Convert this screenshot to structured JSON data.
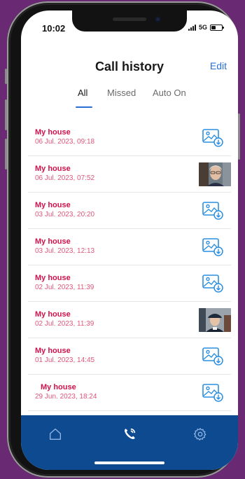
{
  "status_bar": {
    "time": "10:02",
    "network": "5G"
  },
  "header": {
    "title": "Call history",
    "edit_label": "Edit"
  },
  "tabs": [
    {
      "label": "All",
      "active": true
    },
    {
      "label": "Missed",
      "active": false
    },
    {
      "label": "Auto On",
      "active": false
    }
  ],
  "calls": [
    {
      "name": "My house",
      "date": "06 Jul. 2023, 09:18",
      "thumbnail": "image-download-icon"
    },
    {
      "name": "My house",
      "date": "06 Jul. 2023, 07:52",
      "thumbnail": "photo-person-glasses"
    },
    {
      "name": "My house",
      "date": "03 Jul. 2023, 20:20",
      "thumbnail": "image-download-icon"
    },
    {
      "name": "My house",
      "date": "03 Jul. 2023, 12:13",
      "thumbnail": "image-download-icon"
    },
    {
      "name": "My house",
      "date": "02 Jul. 2023, 11:39",
      "thumbnail": "image-download-icon"
    },
    {
      "name": "My house",
      "date": "02 Jul. 2023, 11:39",
      "thumbnail": "photo-person-cap"
    },
    {
      "name": "My house",
      "date": "01 Jul. 2023, 14:45",
      "thumbnail": "image-download-icon"
    },
    {
      "name": "My house",
      "date": "29 Jun. 2023, 18:24",
      "thumbnail": "image-download-icon"
    }
  ],
  "tab_bar": {
    "items": [
      {
        "icon": "home-icon",
        "active": false
      },
      {
        "icon": "phone-call-icon",
        "active": true
      },
      {
        "icon": "gear-icon",
        "active": false
      }
    ]
  },
  "colors": {
    "accent": "#2a6fd6",
    "call_name": "#d1124a",
    "call_date": "#e0567a",
    "tab_bar_bg": "#0d4a8f",
    "background": "#6a2a73"
  }
}
